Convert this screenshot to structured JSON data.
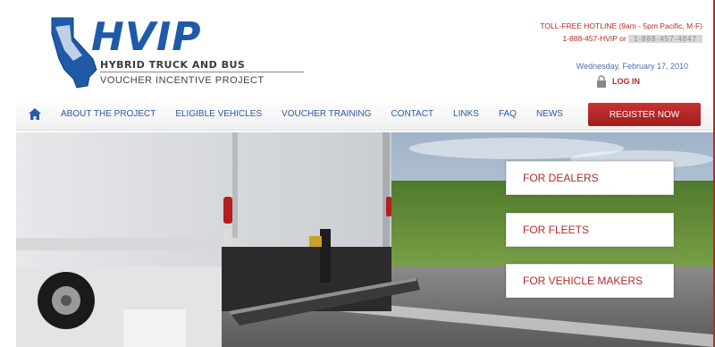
{
  "logo": {
    "title": "HVIP",
    "line1": "HYBRID TRUCK AND BUS",
    "line2": "VOUCHER INCENTIVE PROJECT"
  },
  "hotline": {
    "line1": "TOLL-FREE HOTLINE (9am - 5pm Pacific, M-F)",
    "line2_prefix": "1-888-457-HVIP or",
    "line2_phone": "1-888-457-4847"
  },
  "date": "Wednesday, February 17, 2010",
  "login_label": "LOG IN",
  "nav": {
    "items": [
      "ABOUT THE PROJECT",
      "ELIGIBLE VEHICLES",
      "VOUCHER TRAINING",
      "CONTACT",
      "LINKS",
      "FAQ",
      "NEWS"
    ],
    "register": "REGISTER NOW"
  },
  "cta": {
    "dealers": "FOR DEALERS",
    "fleets": "FOR FLEETS",
    "makers": "FOR VEHICLE MAKERS"
  },
  "colors": {
    "brand_blue": "#1f5aa8",
    "brand_red": "#b42a2a"
  },
  "icons": [
    "california-state-icon",
    "lock-icon",
    "home-icon"
  ]
}
